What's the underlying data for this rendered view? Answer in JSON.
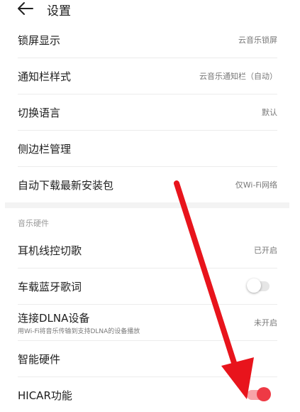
{
  "header": {
    "title": "设置",
    "back_icon": "arrow-left-icon"
  },
  "rows_top": [
    {
      "label": "锁屏显示",
      "value": "云音乐锁屏"
    },
    {
      "label": "通知栏样式",
      "value": "云音乐通知栏（自动）"
    },
    {
      "label": "切换语言",
      "value": "默认"
    },
    {
      "label": "侧边栏管理",
      "value": ""
    },
    {
      "label": "自动下载最新安装包",
      "value": "仅Wi-Fi网络"
    }
  ],
  "section": {
    "label": "音乐硬件"
  },
  "rows_bottom": [
    {
      "label": "耳机线控切歌",
      "value": "已开启"
    },
    {
      "label": "车载蓝牙歌词",
      "value": ""
    },
    {
      "label": "连接DLNA设备",
      "sub": "用Wi-Fi将音乐传输到支持DLNA的设备播放",
      "value": "未开启"
    },
    {
      "label": "智能硬件",
      "value": ""
    },
    {
      "label": "HICAR功能",
      "value": ""
    }
  ],
  "toggles": {
    "car_bluetooth_lyrics": false,
    "hicar": true
  },
  "colors": {
    "accent": "#ee3a45",
    "arrow": "#e8141c"
  }
}
